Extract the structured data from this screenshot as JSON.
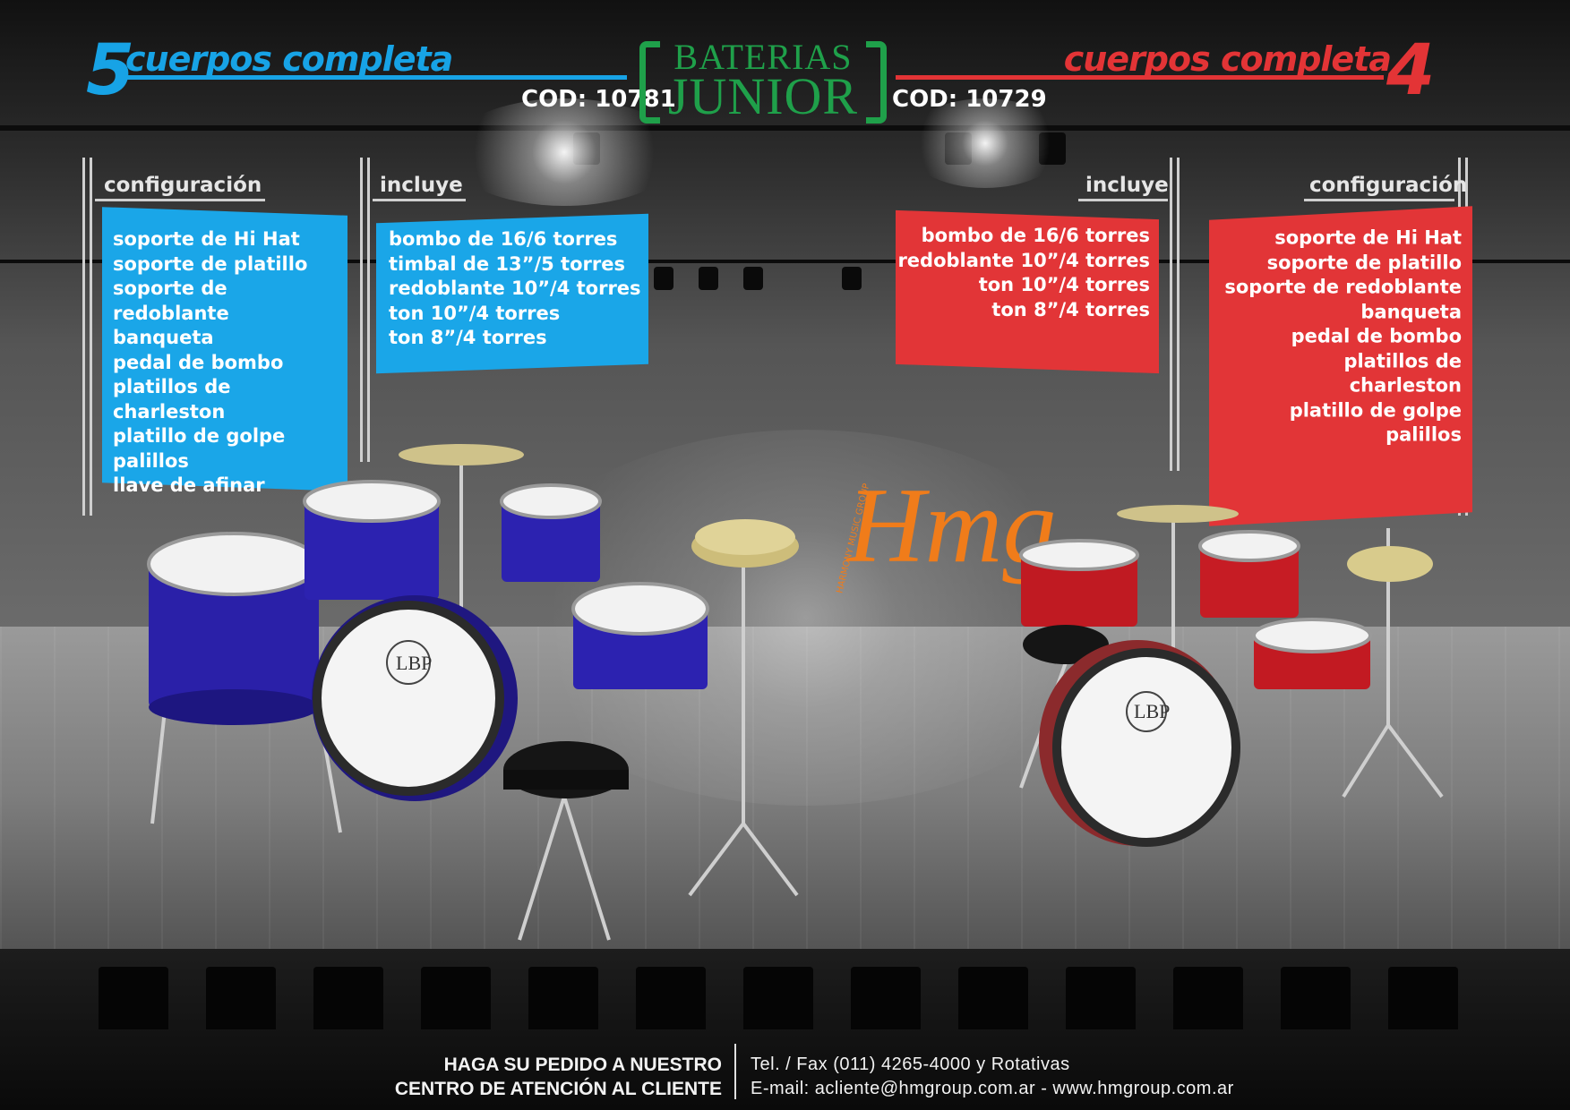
{
  "header": {
    "left_number": "5",
    "left_title": "cuerpos completa",
    "left_code": "COD: 10781",
    "brand_line1": "BATERIAS",
    "brand_line2": "JUNIOR",
    "right_code": "COD: 10729",
    "right_title": "cuerpos completa",
    "right_number": "4"
  },
  "left_kit": {
    "config_label": "configuración",
    "config_items": [
      "soporte de Hi Hat",
      "soporte de platillo",
      "soporte de redoblante",
      "banqueta",
      "pedal de bombo",
      "platillos de charleston",
      "platillo de golpe",
      "palillos",
      "llave de afinar"
    ],
    "includes_label": "incluye",
    "includes_items": [
      "bombo de 16/6 torres",
      "timbal de 13”/5 torres",
      "redoblante 10”/4 torres",
      "ton 10”/4 torres",
      "ton 8”/4 torres"
    ],
    "drum_badge": "LBP"
  },
  "right_kit": {
    "includes_label": "incluye",
    "includes_items": [
      "bombo de 16/6 torres",
      "redoblante 10”/4 torres",
      "ton 10”/4 torres",
      "ton 8”/4 torres"
    ],
    "config_label": "configuración",
    "config_items": [
      "soporte de Hi Hat",
      "soporte de platillo",
      "soporte de redoblante",
      "banqueta",
      "pedal de bombo",
      "platillos de",
      "charleston",
      "platillo de golpe",
      "palillos"
    ],
    "drum_badge": "LBP"
  },
  "logo": {
    "main": "Hmg",
    "sub": "HARMONY MUSIC GROUP"
  },
  "footer": {
    "cta_line1": "HAGA SU PEDIDO  A NUESTRO",
    "cta_line2": "CENTRO DE ATENCIÓN AL CLIENTE",
    "phone": "Tel. / Fax (011) 4265-4000 y Rotativas",
    "contact": "E-mail: acliente@hmgroup.com.ar - www.hmgroup.com.ar"
  },
  "colors": {
    "blue": "#1aa6e8",
    "red": "#e23537",
    "green": "#1fa04a",
    "orange": "#f07c1a"
  }
}
